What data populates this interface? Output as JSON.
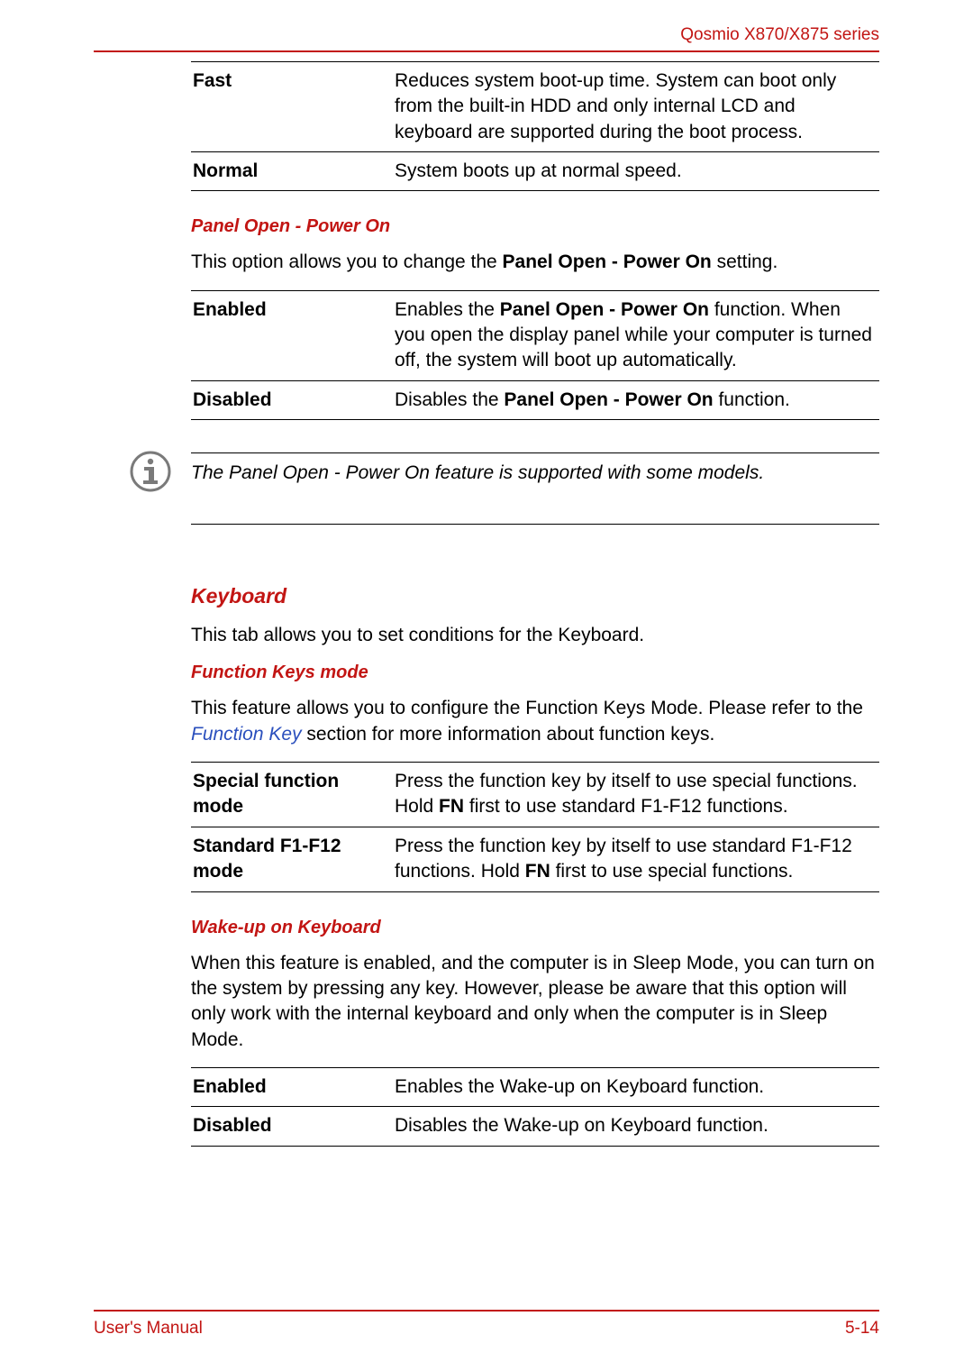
{
  "header": {
    "series": "Qosmio X870/X875 series"
  },
  "footer": {
    "left": "User's Manual",
    "right": "5-14"
  },
  "bootSpeed": {
    "rows": [
      {
        "term": "Fast",
        "desc": "Reduces system boot-up time. System can boot only from the built-in HDD and only internal LCD and keyboard are supported during the boot process."
      },
      {
        "term": "Normal",
        "desc": "System boots up at normal speed."
      }
    ]
  },
  "panelOpen": {
    "heading": "Panel Open - Power On",
    "intro_pre": "This option allows you to change the ",
    "intro_bold": "Panel Open - Power On",
    "intro_post": " setting.",
    "rows": [
      {
        "term": "Enabled",
        "desc_pre": "Enables the ",
        "desc_bold": "Panel Open - Power On",
        "desc_post": " function. When you open the display panel while your computer is turned off, the system will boot up automatically."
      },
      {
        "term": "Disabled",
        "desc_pre": "Disables the ",
        "desc_bold": "Panel Open - Power On",
        "desc_post": " function."
      }
    ],
    "note": "The Panel Open - Power On feature is supported with some models."
  },
  "keyboard": {
    "heading": "Keyboard",
    "intro": "This tab allows you to set conditions for the Keyboard."
  },
  "fnKeys": {
    "heading": "Function Keys mode",
    "intro_pre": "This feature allows you to configure the Function Keys Mode. Please refer to the ",
    "intro_link": "Function Key",
    "intro_post": " section for more information about function keys.",
    "rows": [
      {
        "term": "Special function mode",
        "desc_pre": "Press the function key by itself to use special functions. Hold ",
        "desc_bold": "FN",
        "desc_post": " first to use standard F1-F12 functions."
      },
      {
        "term": "Standard F1-F12 mode",
        "desc_pre": "Press the function key by itself to use standard F1-F12 functions. Hold ",
        "desc_bold": "FN",
        "desc_post": " first to use special functions."
      }
    ]
  },
  "wakeKbd": {
    "heading": "Wake-up on Keyboard",
    "intro": "When this feature is enabled, and the computer is in Sleep Mode, you can turn on the system by pressing any key. However, please be aware that this option will only work with the internal keyboard and only when the computer is in Sleep Mode.",
    "rows": [
      {
        "term": "Enabled",
        "desc": "Enables the Wake-up on Keyboard function."
      },
      {
        "term": "Disabled",
        "desc": "Disables the Wake-up on Keyboard function."
      }
    ]
  }
}
